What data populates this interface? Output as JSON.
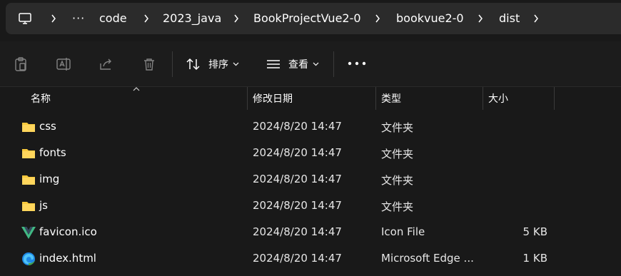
{
  "breadcrumb": {
    "items": [
      "code",
      "2023_java",
      "BookProjectVue2-0",
      "bookvue2-0",
      "dist"
    ],
    "overflow_label": "···"
  },
  "toolbar": {
    "sort_label": "排序",
    "view_label": "查看",
    "more_label": "···"
  },
  "columns": {
    "name": "名称",
    "modified": "修改日期",
    "type": "类型",
    "size": "大小"
  },
  "files": [
    {
      "name": "css",
      "modified": "2024/8/20 14:47",
      "type": "文件夹",
      "size": "",
      "icon": "folder-icon"
    },
    {
      "name": "fonts",
      "modified": "2024/8/20 14:47",
      "type": "文件夹",
      "size": "",
      "icon": "folder-icon"
    },
    {
      "name": "img",
      "modified": "2024/8/20 14:47",
      "type": "文件夹",
      "size": "",
      "icon": "folder-icon"
    },
    {
      "name": "js",
      "modified": "2024/8/20 14:47",
      "type": "文件夹",
      "size": "",
      "icon": "folder-icon"
    },
    {
      "name": "favicon.ico",
      "modified": "2024/8/20 14:47",
      "type": "Icon File",
      "size": "5 KB",
      "icon": "vue-logo-icon"
    },
    {
      "name": "index.html",
      "modified": "2024/8/20 14:47",
      "type": "Microsoft Edge ...",
      "size": "1 KB",
      "icon": "edge-icon"
    }
  ],
  "colors": {
    "folder": "#f8c83c",
    "vue_green": "#41b883",
    "edge_blue": "#1e88e5",
    "background": "#191919"
  }
}
